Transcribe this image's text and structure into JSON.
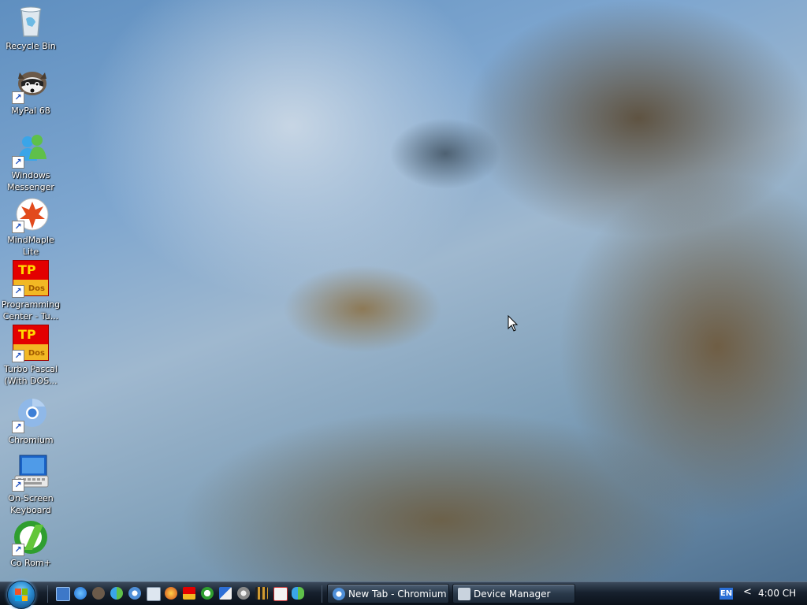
{
  "desktop_icons": [
    {
      "name": "Recycle Bin",
      "icon": "recycle-bin-icon"
    },
    {
      "name": "MyPal 68",
      "icon": "mypal-raccoon-icon"
    },
    {
      "name": "Windows Messenger",
      "icon": "messenger-icon"
    },
    {
      "name": "MindMaple Lite",
      "icon": "mindmaple-icon"
    },
    {
      "name": "Programming Center -  Tu...",
      "icon": "tp-dos-icon"
    },
    {
      "name": "Turbo Pascal (With DOS...",
      "icon": "tp-dos-icon"
    },
    {
      "name": "Chromium",
      "icon": "chromium-icon"
    },
    {
      "name": "On-Screen Keyboard",
      "icon": "keyboard-icon"
    },
    {
      "name": "Co Rom+",
      "icon": "corom-icon"
    }
  ],
  "tp_icon": {
    "top": "TP",
    "bottom": "Dos"
  },
  "taskbar": {
    "tasks": [
      {
        "label": "New Tab - Chromium",
        "icon": "chromium-icon"
      },
      {
        "label": "Device Manager",
        "icon": "device-manager-icon"
      }
    ],
    "quick_launch": [
      "show-desktop-icon",
      "ie-icon",
      "mypal-icon",
      "messenger-icon",
      "chromium-icon",
      "keyboard-icon",
      "tool-icon",
      "tp-icon",
      "corom-icon",
      "mail-icon",
      "gear-icon",
      "film-icon",
      "cards-icon",
      "users-icon"
    ],
    "language": "EN",
    "clock": "4:00 CH",
    "tray_chevron": "<"
  },
  "colors": {
    "taskbar": "#17212e",
    "accent": "#2b6fd6"
  }
}
